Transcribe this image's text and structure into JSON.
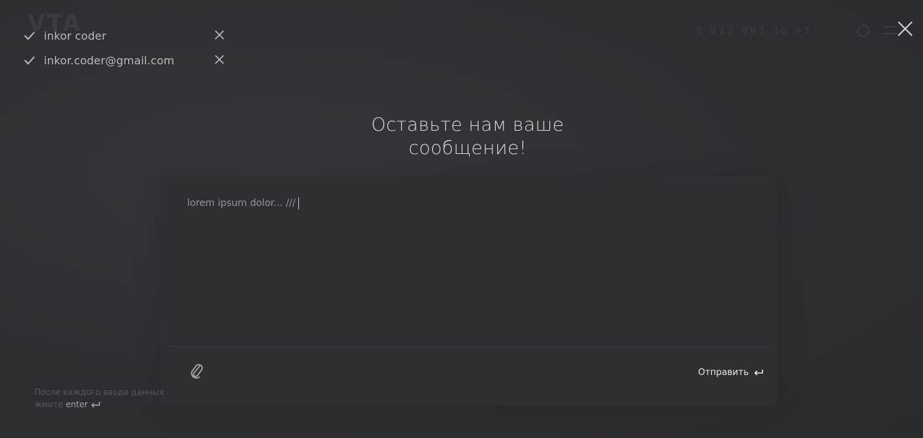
{
  "background": {
    "logo": "VTA",
    "phone": "8 812 993 30 93"
  },
  "entered_values": [
    {
      "value": "inkor coder"
    },
    {
      "value": "inkor.coder@gmail.com"
    }
  ],
  "form": {
    "title_line1": "Оставьте нам ваше",
    "title_line2": "сообщение!",
    "message_value": "lorem ipsum dolor... ///",
    "send_label": "Отправить"
  },
  "hint": {
    "text": "После каждого ввода данных жмите",
    "key": "enter"
  },
  "icons": {
    "close": "close-icon",
    "check": "check-icon",
    "remove": "remove-icon",
    "attach": "paperclip-icon",
    "enter": "enter-return-icon"
  },
  "colors": {
    "background": "#2f3034",
    "panel": "#2e2f33",
    "text_primary": "#d6d7da",
    "text_muted": "#56585e"
  }
}
